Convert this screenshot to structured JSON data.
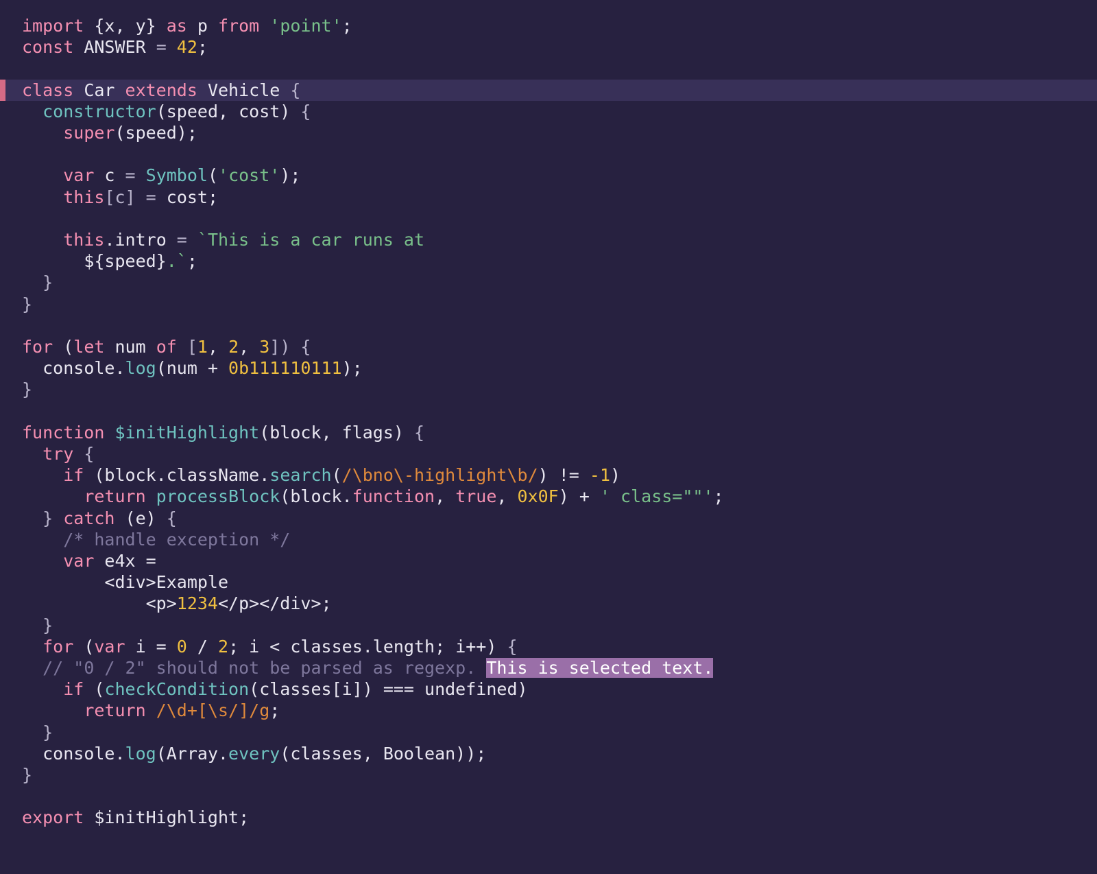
{
  "editor": {
    "language": "javascript",
    "background": "#272140",
    "foreground": "#e8e6f0",
    "highlighted_line_background": "#383058",
    "highlighted_line_marker_color": "#d46a85",
    "selection_background": "#9a6fa8",
    "selection_foreground": "#ffffff",
    "palette": {
      "keyword": "#f48fb1",
      "string": "#79c08a",
      "number": "#f0c040",
      "function": "#6fc3c0",
      "comment": "#7e779c",
      "regexp": "#e08a3c",
      "punctuation": "#b9b4cc"
    },
    "highlighted_line_number": 4,
    "selected_text": "This is selected text."
  },
  "code": {
    "l1": {
      "kw1": "import",
      "p1": " {x, y} ",
      "kw2": "as",
      "p2": " p ",
      "kw3": "from",
      "p3": " ",
      "str": "'point'",
      "p4": ";"
    },
    "l2": {
      "kw": "const",
      "name": " ANSWER ",
      "eq": "= ",
      "num": "42",
      "semi": ";"
    },
    "l3": {
      "text": ""
    },
    "l4": {
      "kw1": "class",
      "name": " Car ",
      "kw2": "extends",
      "title": " Vehicle ",
      "brace": "{"
    },
    "l5": {
      "fn": "constructor",
      "args": "(speed, cost) ",
      "brace": "{"
    },
    "l6": {
      "kw": "super",
      "rest": "(speed);"
    },
    "l7": {
      "text": ""
    },
    "l8": {
      "kw": "var",
      "name": " c ",
      "eq": "= ",
      "fn": "Symbol",
      "p1": "(",
      "str": "'cost'",
      "p2": ");"
    },
    "l9": {
      "kw": "this",
      "p1": "[c] ",
      "eq": "= ",
      "rest": "cost;"
    },
    "l10": {
      "text": ""
    },
    "l11": {
      "kw": "this",
      "prop": ".intro ",
      "eq": "= ",
      "str": "`This is a car runs at"
    },
    "l12": {
      "subst": "${speed}",
      "str": ".`",
      "semi": ";"
    },
    "l13": {
      "brace": "}"
    },
    "l14": {
      "brace": "}"
    },
    "l15": {
      "text": ""
    },
    "l16": {
      "kw1": "for",
      "p1": " (",
      "kw2": "let",
      "p2": " num ",
      "kw3": "of",
      "p3": " [",
      "n1": "1",
      "c1": ", ",
      "n2": "2",
      "c2": ", ",
      "n3": "3",
      "p4": "]) ",
      "brace": "{"
    },
    "l17": {
      "obj": "console",
      "dot": ".",
      "fn": "log",
      "p1": "(num + ",
      "num": "0b111110111",
      "p2": ");"
    },
    "l18": {
      "brace": "}"
    },
    "l19": {
      "text": ""
    },
    "l20": {
      "kw": "function",
      "fn": " $initHighlight",
      "args": "(block, flags) ",
      "brace": "{"
    },
    "l21": {
      "kw": "try",
      "brace": " {"
    },
    "l22": {
      "kw": "if",
      "p1": " (block.className.",
      "fn": "search",
      "p2": "(",
      "rgx": "/\\bno\\-highlight\\b/",
      "p3": ") != ",
      "num": "-1",
      "p4": ")"
    },
    "l23": {
      "kw": "return",
      "fn": " processBlock",
      "p1": "(block.",
      "lit1": "function",
      "p2": ", ",
      "lit2": "true",
      "p3": ", ",
      "num": "0x0F",
      "p4": ") + ",
      "str": "' class=\"\"'",
      "semi": ";"
    },
    "l24": {
      "brace": "} ",
      "kw": "catch",
      "rest": " (e) ",
      "brace2": "{"
    },
    "l25": {
      "cmt": "/* handle exception */"
    },
    "l26": {
      "kw": "var",
      "rest": " e4x ="
    },
    "l27": {
      "text": "<div>Example"
    },
    "l28": {
      "p1": "<p>",
      "num": "1234",
      "p2": "</p></div>;"
    },
    "l29": {
      "brace": "}"
    },
    "l30": {
      "kw1": "for",
      "p1": " (",
      "kw2": "var",
      "p2": " i = ",
      "n1": "0",
      "p3": " / ",
      "n2": "2",
      "p4": "; i < classes.length; i++) ",
      "brace": "{"
    },
    "l31": {
      "cmt": "// \"0 / 2\" should not be parsed as regexp. ",
      "sel": "This is selected text."
    },
    "l32": {
      "kw": "if",
      "p1": " (",
      "fn": "checkCondition",
      "p2": "(classes[i]) === undefined)"
    },
    "l33": {
      "kw": "return",
      "p1": " ",
      "rgx": "/\\d+[\\s/]/g",
      "semi": ";"
    },
    "l34": {
      "brace": "}"
    },
    "l35": {
      "obj": "console",
      "dot": ".",
      "fn": "log",
      "p1": "(Array.",
      "fn2": "every",
      "p2": "(classes, Boolean));"
    },
    "l36": {
      "brace": "}"
    },
    "l37": {
      "text": ""
    },
    "l38": {
      "kw": "export",
      "rest": " $initHighlight;"
    }
  }
}
